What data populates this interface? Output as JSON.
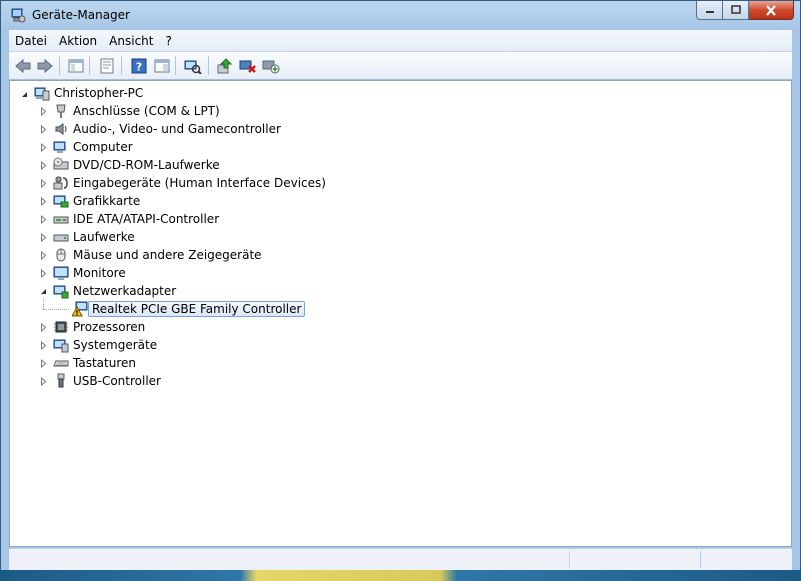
{
  "window": {
    "title": "Geräte-Manager"
  },
  "menubar": {
    "items": [
      "Datei",
      "Aktion",
      "Ansicht",
      "?"
    ]
  },
  "toolbar": {
    "buttons": [
      "back-icon",
      "forward-icon",
      "show-hide-console-tree-icon",
      "properties-icon",
      "help-icon",
      "details-view-icon",
      "scan-hardware-icon",
      "update-driver-icon",
      "disable-device-icon",
      "uninstall-device-icon"
    ]
  },
  "tree": {
    "root": "Christopher-PC",
    "categories": [
      {
        "label": "Anschlüsse (COM & LPT)",
        "icon": "port-icon"
      },
      {
        "label": "Audio-, Video- und Gamecontroller",
        "icon": "audio-icon"
      },
      {
        "label": "Computer",
        "icon": "computer-icon"
      },
      {
        "label": "DVD/CD-ROM-Laufwerke",
        "icon": "dvd-drive-icon"
      },
      {
        "label": "Eingabegeräte (Human Interface Devices)",
        "icon": "hid-icon"
      },
      {
        "label": "Grafikkarte",
        "icon": "display-adapter-icon"
      },
      {
        "label": "IDE ATA/ATAPI-Controller",
        "icon": "ide-controller-icon"
      },
      {
        "label": "Laufwerke",
        "icon": "disk-drive-icon"
      },
      {
        "label": "Mäuse und andere Zeigegeräte",
        "icon": "mouse-icon"
      },
      {
        "label": "Monitore",
        "icon": "monitor-icon"
      },
      {
        "label": "Netzwerkadapter",
        "icon": "network-adapter-icon"
      },
      {
        "label": "Realtek PCIe GBE Family Controller",
        "icon": "warning-network-icon"
      },
      {
        "label": "Prozessoren",
        "icon": "processor-icon"
      },
      {
        "label": "Systemgeräte",
        "icon": "system-device-icon"
      },
      {
        "label": "Tastaturen",
        "icon": "keyboard-icon"
      },
      {
        "label": "USB-Controller",
        "icon": "usb-icon"
      }
    ]
  },
  "statusbar": {
    "pane1": "",
    "pane2": "",
    "pane3": ""
  },
  "colors": {
    "selection_border": "#7da2ce",
    "selection_fill": "#dbe8f7",
    "window_frame": "#a7c6e6",
    "close_button": "#cf4a2e",
    "warning_yellow": "#f5c800"
  }
}
